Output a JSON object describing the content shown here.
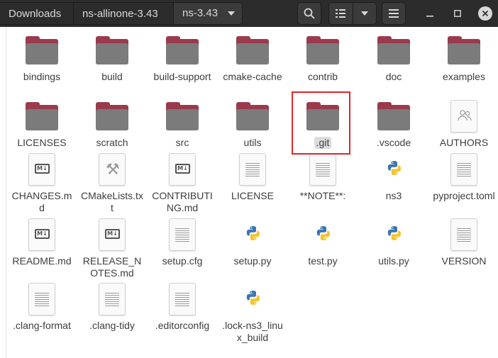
{
  "breadcrumbs": [
    "Downloads",
    "ns-allinone-3.43",
    "ns-3.43"
  ],
  "icons": {
    "search": "search-icon",
    "view": "list-view-icon",
    "view_options": "chevron-down-icon",
    "menu": "hamburger-menu-icon",
    "minimize": "minimize-icon",
    "maximize": "maximize-icon",
    "close": "close-icon"
  },
  "colors": {
    "folder_tab": "#9b3a4d",
    "folder_body": "#7b7b7b",
    "selection_box": "#e0252b",
    "header_bg": "#2c2c2c"
  },
  "files": [
    {
      "name": "bindings",
      "type": "folder"
    },
    {
      "name": "build",
      "type": "folder"
    },
    {
      "name": "build-support",
      "type": "folder"
    },
    {
      "name": "cmake-cache",
      "type": "folder"
    },
    {
      "name": "contrib",
      "type": "folder"
    },
    {
      "name": "doc",
      "type": "folder"
    },
    {
      "name": "examples",
      "type": "folder"
    },
    {
      "name": "LICENSES",
      "type": "folder"
    },
    {
      "name": "scratch",
      "type": "folder"
    },
    {
      "name": "src",
      "type": "folder"
    },
    {
      "name": "utils",
      "type": "folder"
    },
    {
      "name": ".git",
      "type": "folder",
      "selected": true
    },
    {
      "name": ".vscode",
      "type": "folder"
    },
    {
      "name": "AUTHORS",
      "type": "contacts"
    },
    {
      "name": "CHANGES.md",
      "type": "markdown"
    },
    {
      "name": "CMakeLists.txt",
      "type": "cmake"
    },
    {
      "name": "CONTRIBUTING.md",
      "type": "markdown"
    },
    {
      "name": "LICENSE",
      "type": "text"
    },
    {
      "name": "**NOTE**:",
      "type": "text"
    },
    {
      "name": "ns3",
      "type": "python"
    },
    {
      "name": "pyproject.toml",
      "type": "text"
    },
    {
      "name": "README.md",
      "type": "markdown"
    },
    {
      "name": "RELEASE_NOTES.md",
      "type": "markdown"
    },
    {
      "name": "setup.cfg",
      "type": "text"
    },
    {
      "name": "setup.py",
      "type": "python"
    },
    {
      "name": "test.py",
      "type": "python"
    },
    {
      "name": "utils.py",
      "type": "python"
    },
    {
      "name": "VERSION",
      "type": "text"
    },
    {
      "name": ".clang-format",
      "type": "text"
    },
    {
      "name": ".clang-tidy",
      "type": "text"
    },
    {
      "name": ".editorconfig",
      "type": "text"
    },
    {
      "name": ".lock-ns3_linux_build",
      "type": "python"
    }
  ]
}
